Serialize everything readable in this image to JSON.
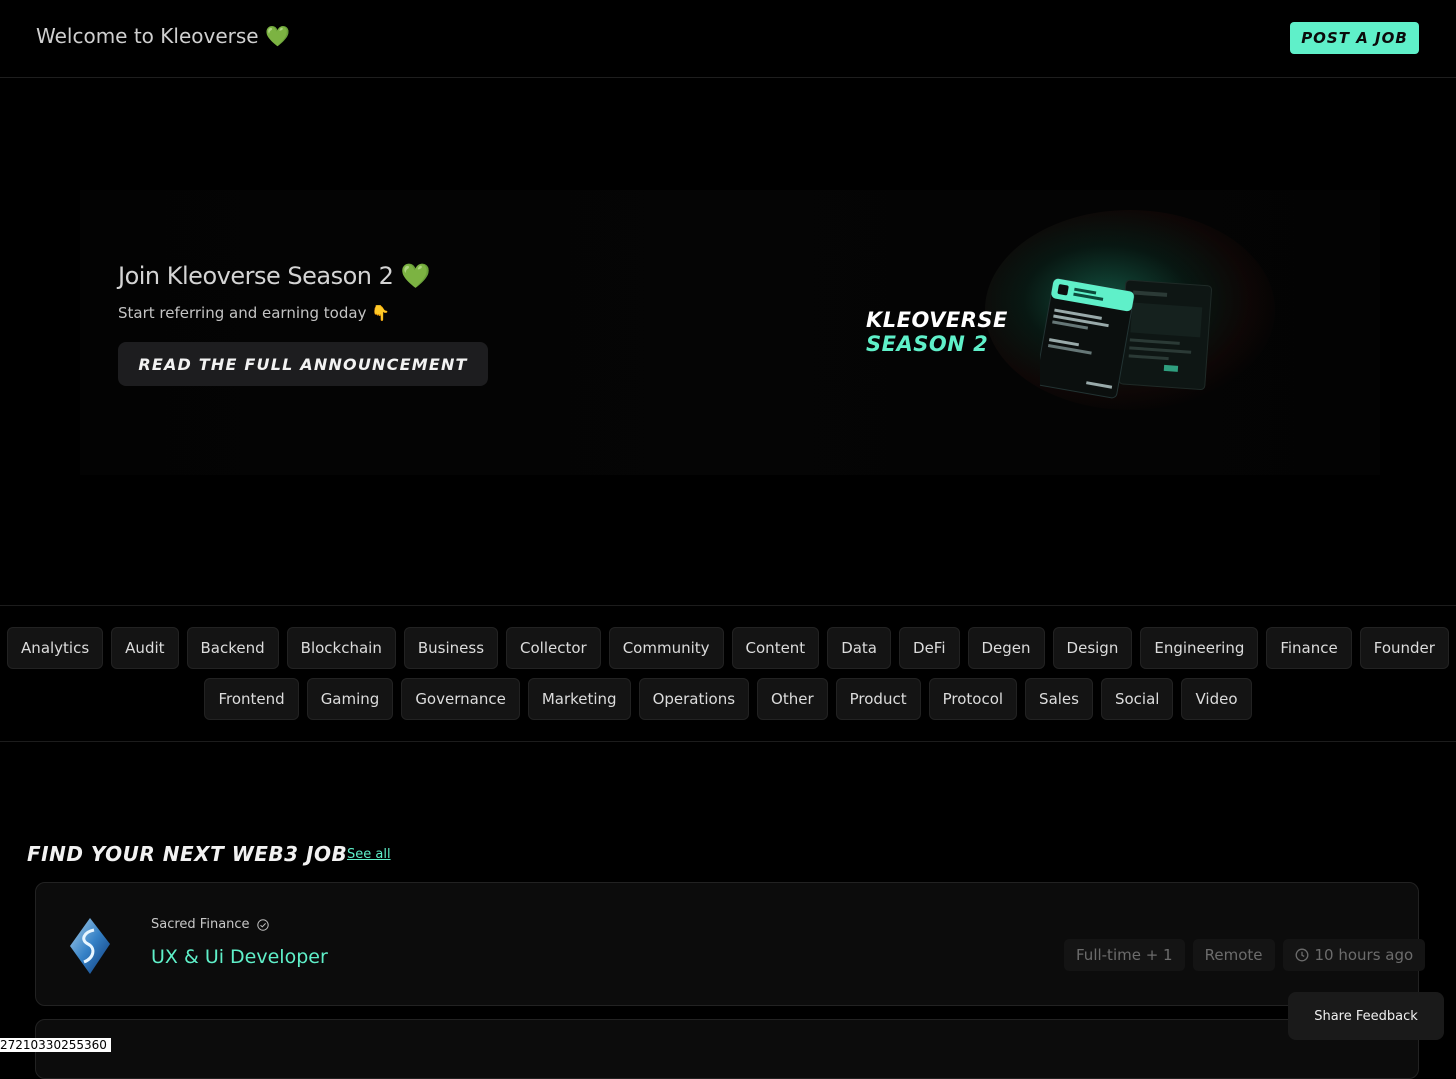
{
  "header": {
    "welcome_text": "Welcome to Kleoverse",
    "welcome_emoji": "💚",
    "post_job_label": "POST A JOB"
  },
  "hero": {
    "title": "Join Kleoverse Season 2",
    "title_emoji": "💚",
    "subtitle": "Start referring and earning today",
    "subtitle_emoji": "👇",
    "cta_label": "READ THE FULL ANNOUNCEMENT",
    "art_line_1": "KLEOVERSE",
    "art_line_2": "SEASON 2"
  },
  "categories": {
    "row1": [
      "Analytics",
      "Audit",
      "Backend",
      "Blockchain",
      "Business",
      "Collector",
      "Community",
      "Content",
      "Data",
      "DeFi",
      "Degen",
      "Design",
      "Engineering",
      "Finance",
      "Founder"
    ],
    "row2": [
      "Frontend",
      "Gaming",
      "Governance",
      "Marketing",
      "Operations",
      "Other",
      "Product",
      "Protocol",
      "Sales",
      "Social",
      "Video"
    ]
  },
  "jobs": {
    "section_title": "FIND YOUR NEXT WEB3 JOB",
    "see_all_label": "See all",
    "items": [
      {
        "company": "Sacred Finance",
        "title": "UX & Ui Developer",
        "employment": "Full-time + 1",
        "location": "Remote",
        "posted": "10 hours ago"
      }
    ]
  },
  "feedback_label": "Share Feedback",
  "corner_id": "27210330255360",
  "colors": {
    "accent": "#5ff0c9",
    "background": "#000000",
    "card": "#0c0c0c",
    "heart": "#5fd642"
  }
}
